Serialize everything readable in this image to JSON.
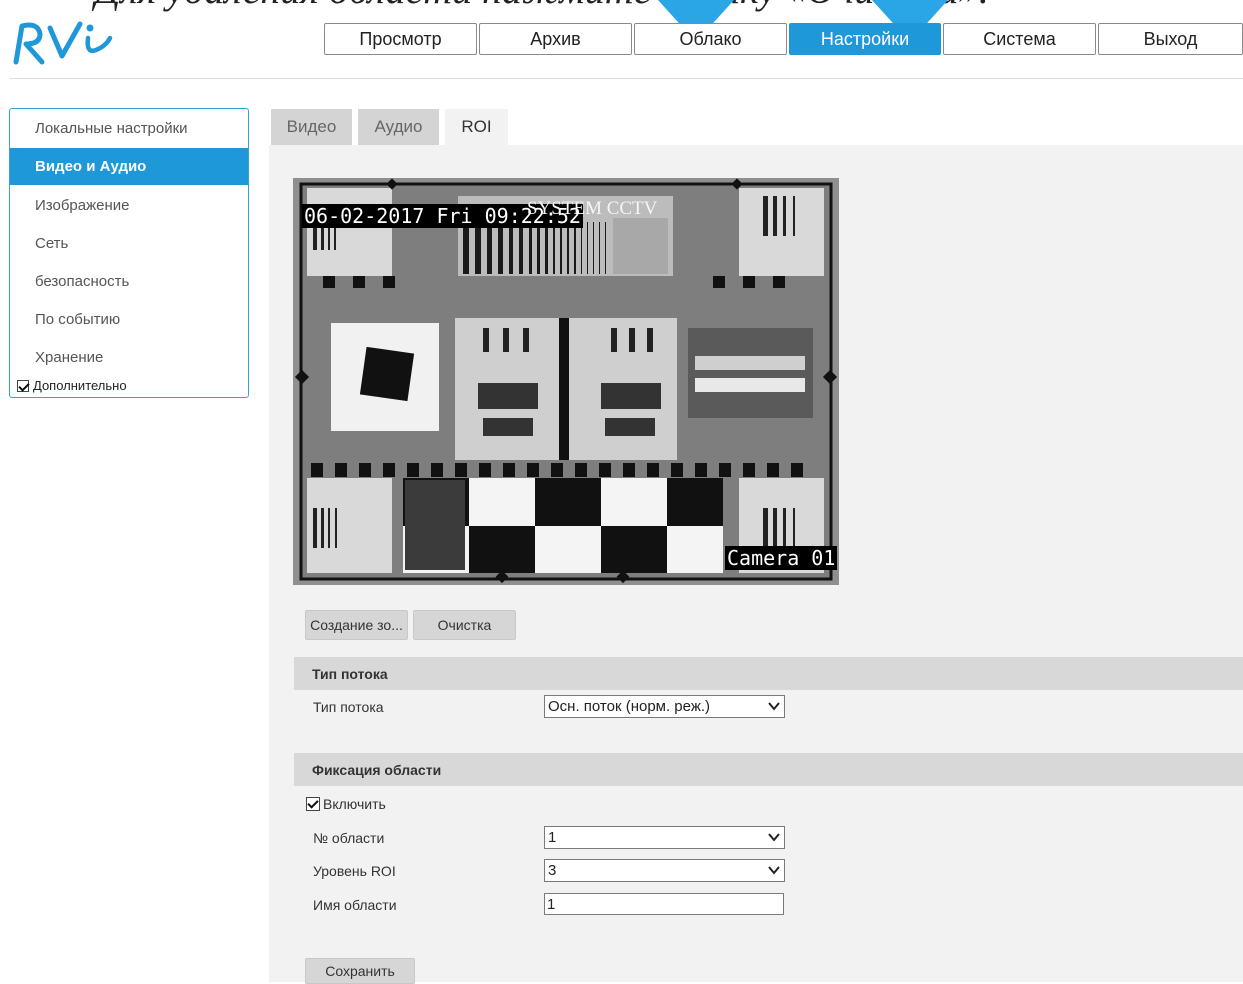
{
  "top_caption": "Для удаления области нажмите кнопку «Очистка».",
  "app": {
    "logo_text": "RVi",
    "brand_color": "#1e98d8"
  },
  "nav": {
    "items": [
      {
        "label": "Просмотр"
      },
      {
        "label": "Архив"
      },
      {
        "label": "Облако"
      },
      {
        "label": "Настройки",
        "active": true
      },
      {
        "label": "Система"
      },
      {
        "label": "Выход"
      }
    ]
  },
  "sidebar": {
    "items": [
      {
        "label": "Локальные настройки"
      },
      {
        "label": "Видео и Аудио",
        "active": true
      },
      {
        "label": "Изображение"
      },
      {
        "label": "Сеть"
      },
      {
        "label": "безопасность"
      },
      {
        "label": "По событию"
      },
      {
        "label": "Хранение"
      },
      {
        "label": "Дополнительно",
        "checkbox": true,
        "checked": true
      }
    ]
  },
  "tabs": [
    {
      "label": "Видео"
    },
    {
      "label": "Аудио"
    },
    {
      "label": "ROI",
      "active": true
    }
  ],
  "camera": {
    "timestamp": "06-02-2017 Fri 09:22:52",
    "camera_name": "Camera 01",
    "chart_brand": "SYSTEM CCTV"
  },
  "area_buttons": {
    "create": "Создание зо...",
    "clear": "Очистка"
  },
  "stream_section": {
    "title": "Тип потока",
    "field_label": "Тип потока",
    "field_value": "Осн. поток (норм. реж.)"
  },
  "roi_section": {
    "title": "Фиксация области",
    "enable_label": "Включить",
    "enable_checked": true,
    "area_no_label": "№ области",
    "area_no_value": "1",
    "roi_level_label": "Уровень ROI",
    "roi_level_value": "3",
    "area_name_label": "Имя области",
    "area_name_value": "1"
  },
  "save_button": "Сохранить"
}
